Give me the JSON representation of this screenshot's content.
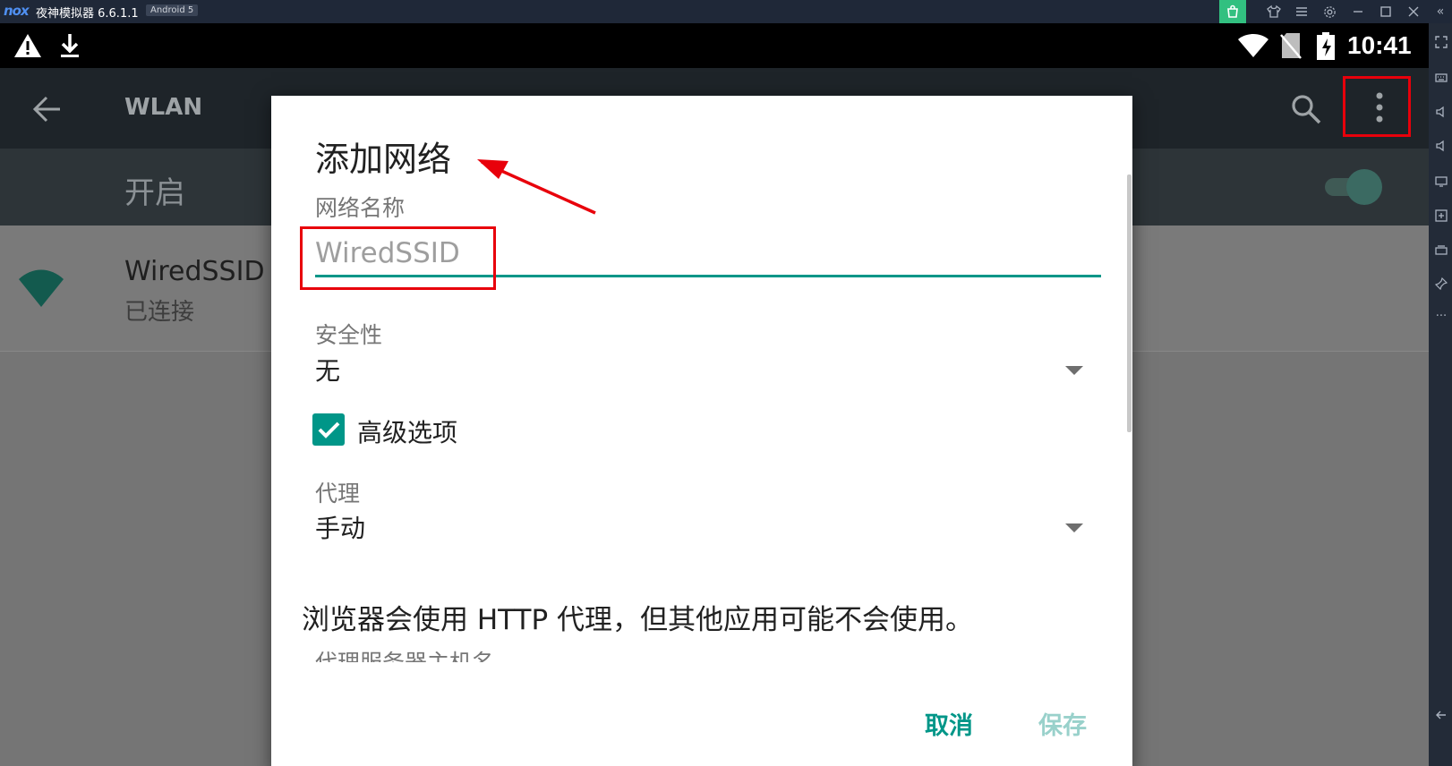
{
  "emulator": {
    "logo": "nox",
    "title": "夜神模拟器 6.6.1.1",
    "android_badge": "Android 5",
    "toolbar_icons": [
      "bag-icon",
      "shirt-icon",
      "menu-icon",
      "settings-icon",
      "minimize-icon",
      "maximize-icon",
      "close-icon"
    ],
    "side_icons": [
      "fullscreen-icon",
      "keyboard-icon",
      "volume-up-icon",
      "volume-down-icon",
      "screen-icon",
      "add-apk-icon",
      "multi-instance-icon",
      "pin-icon",
      "more-icon",
      "back-icon"
    ],
    "side_more": "···",
    "collapse_glyph": "«",
    "accent": "#32c080"
  },
  "statusbar": {
    "time": "10:41",
    "left_icons": [
      "warning-icon",
      "download-icon"
    ],
    "right_icons": [
      "wifi-icon",
      "no-sim-icon",
      "battery-charging-icon"
    ]
  },
  "appbar": {
    "title": "WLAN",
    "icons": [
      "back-arrow-icon",
      "search-icon",
      "overflow-menu-icon"
    ]
  },
  "switchbar": {
    "label": "开启",
    "toggle_on": true
  },
  "networks": [
    {
      "ssid": "WiredSSID",
      "status": "已连接",
      "icon": "wifi-signal-icon"
    }
  ],
  "dialog": {
    "title": "添加网络",
    "network_name_label": "网络名称",
    "network_name_value": "WiredSSID",
    "security_label": "安全性",
    "security_value": "无",
    "advanced_label": "高级选项",
    "advanced_checked": true,
    "proxy_label": "代理",
    "proxy_value": "手动",
    "proxy_note": "浏览器会使用 HTTP 代理，但其他应用可能不会使用。",
    "proxy_host_label": "代理服务器主机名",
    "cancel_label": "取消",
    "save_label": "保存"
  },
  "colors": {
    "accent_teal": "#009688",
    "annotation_red": "#e8000b",
    "appbar_bg": "#1e2429"
  }
}
